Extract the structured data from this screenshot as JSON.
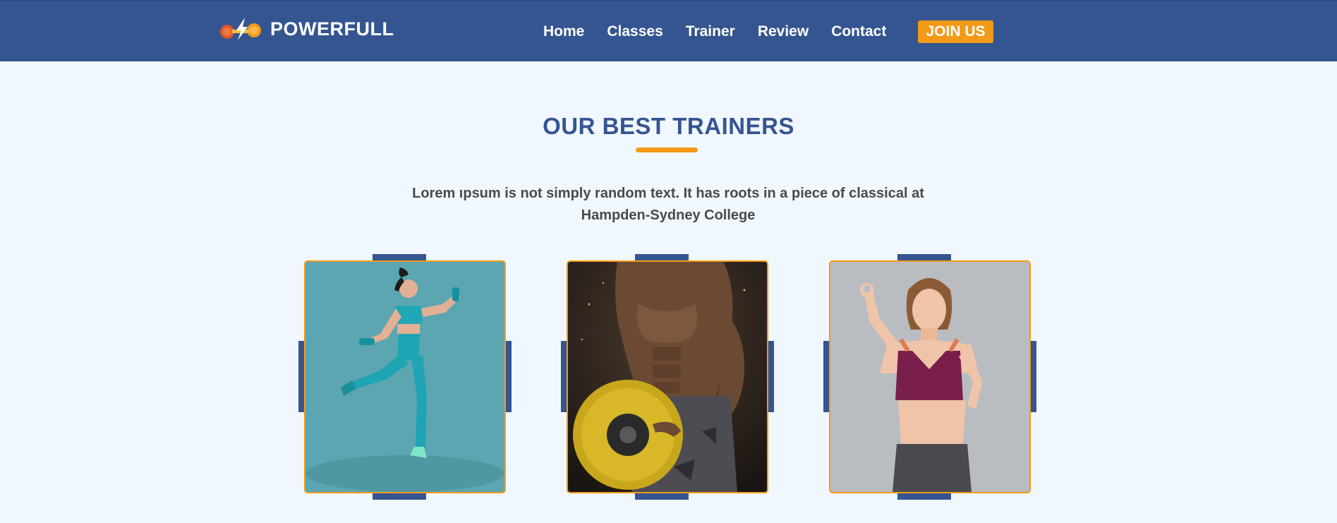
{
  "brand": {
    "name": "POWERFULL",
    "icon": "dumbbell-bolt-icon"
  },
  "nav": {
    "items": [
      {
        "label": "Home"
      },
      {
        "label": "Classes"
      },
      {
        "label": "Trainer"
      },
      {
        "label": "Review"
      },
      {
        "label": "Contact"
      }
    ],
    "cta": "JOIN US"
  },
  "section": {
    "title": "OUR BEST TRAINERS",
    "description": "Lorem ıpsum is not simply random text. It has roots in a piece of classical at Hampden-Sydney College"
  },
  "trainers": [
    {
      "photo": "trainer-photo-woman-dumbbells",
      "bg": "#5ba6b0"
    },
    {
      "photo": "trainer-photo-man-weight-plate",
      "bg": "#2a221c"
    },
    {
      "photo": "trainer-photo-woman-ok-gesture",
      "bg": "#b9bcc0"
    }
  ],
  "colors": {
    "primary": "#355591",
    "accent": "#f39a18",
    "background": "#f1f7fe"
  }
}
